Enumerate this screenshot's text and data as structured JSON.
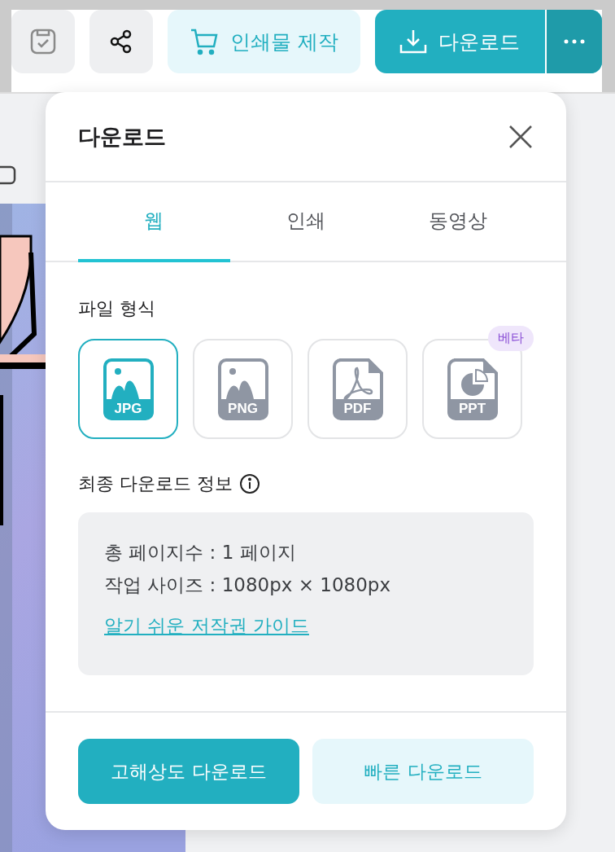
{
  "toolbar": {
    "print_button": {
      "label": "인쇄물 제작"
    },
    "download_button": {
      "label": "다운로드"
    }
  },
  "panel": {
    "title": "다운로드",
    "tabs": [
      {
        "label": "웹",
        "selected": true
      },
      {
        "label": "인쇄",
        "selected": false
      },
      {
        "label": "동영상",
        "selected": false
      }
    ],
    "format_title": "파일 형식",
    "formats": [
      {
        "label": "JPG",
        "selected": true
      },
      {
        "label": "PNG",
        "selected": false
      },
      {
        "label": "PDF",
        "kind": "pdf",
        "selected": false
      },
      {
        "label": "PPT",
        "kind": "ppt",
        "selected": false,
        "badge": "베타"
      }
    ],
    "info_title": "최종 다운로드 정보",
    "info_lines": [
      "총 페이지수 : 1 페이지",
      "작업 사이즈 : 1080px × 1080px"
    ],
    "info_link": "알기 쉬운 저작권 가이드",
    "buttons": [
      {
        "label": "고해상도 다운로드",
        "kind": "primary"
      },
      {
        "label": "빠른 다운로드",
        "kind": "secondary"
      }
    ]
  }
}
